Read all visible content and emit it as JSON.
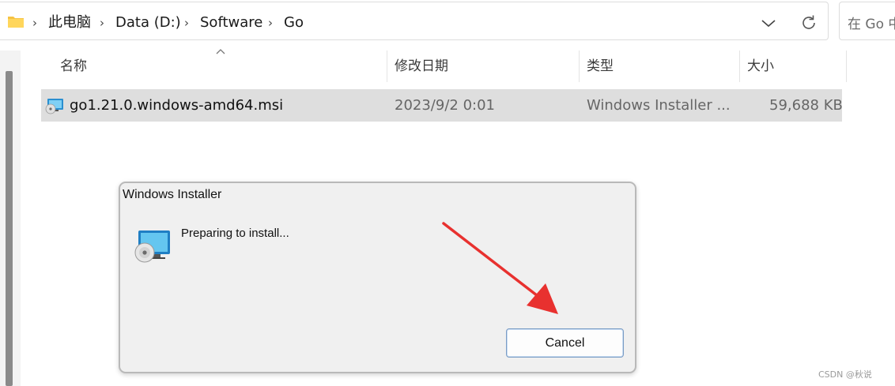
{
  "breadcrumb": {
    "items": [
      "此电脑",
      "Data (D:)",
      "Software",
      "Go"
    ],
    "separator": "›"
  },
  "search": {
    "placeholder": "在 Go 中"
  },
  "columns": {
    "name": "名称",
    "modified": "修改日期",
    "type": "类型",
    "size": "大小"
  },
  "files": [
    {
      "name": "go1.21.0.windows-amd64.msi",
      "modified": "2023/9/2 0:01",
      "type": "Windows Installer ...",
      "size": "59,688 KB"
    }
  ],
  "dialog": {
    "title": "Windows Installer",
    "message": "Preparing to install...",
    "cancel_label": "Cancel"
  },
  "annotation": {
    "arrow_color": "#e8312f"
  },
  "watermark": "CSDN @秋说",
  "icons": {
    "folder": "folder-icon",
    "dropdown": "chevron-down-icon",
    "refresh": "refresh-icon",
    "file": "msi-installer-icon",
    "dialog": "installer-disc-icon"
  }
}
